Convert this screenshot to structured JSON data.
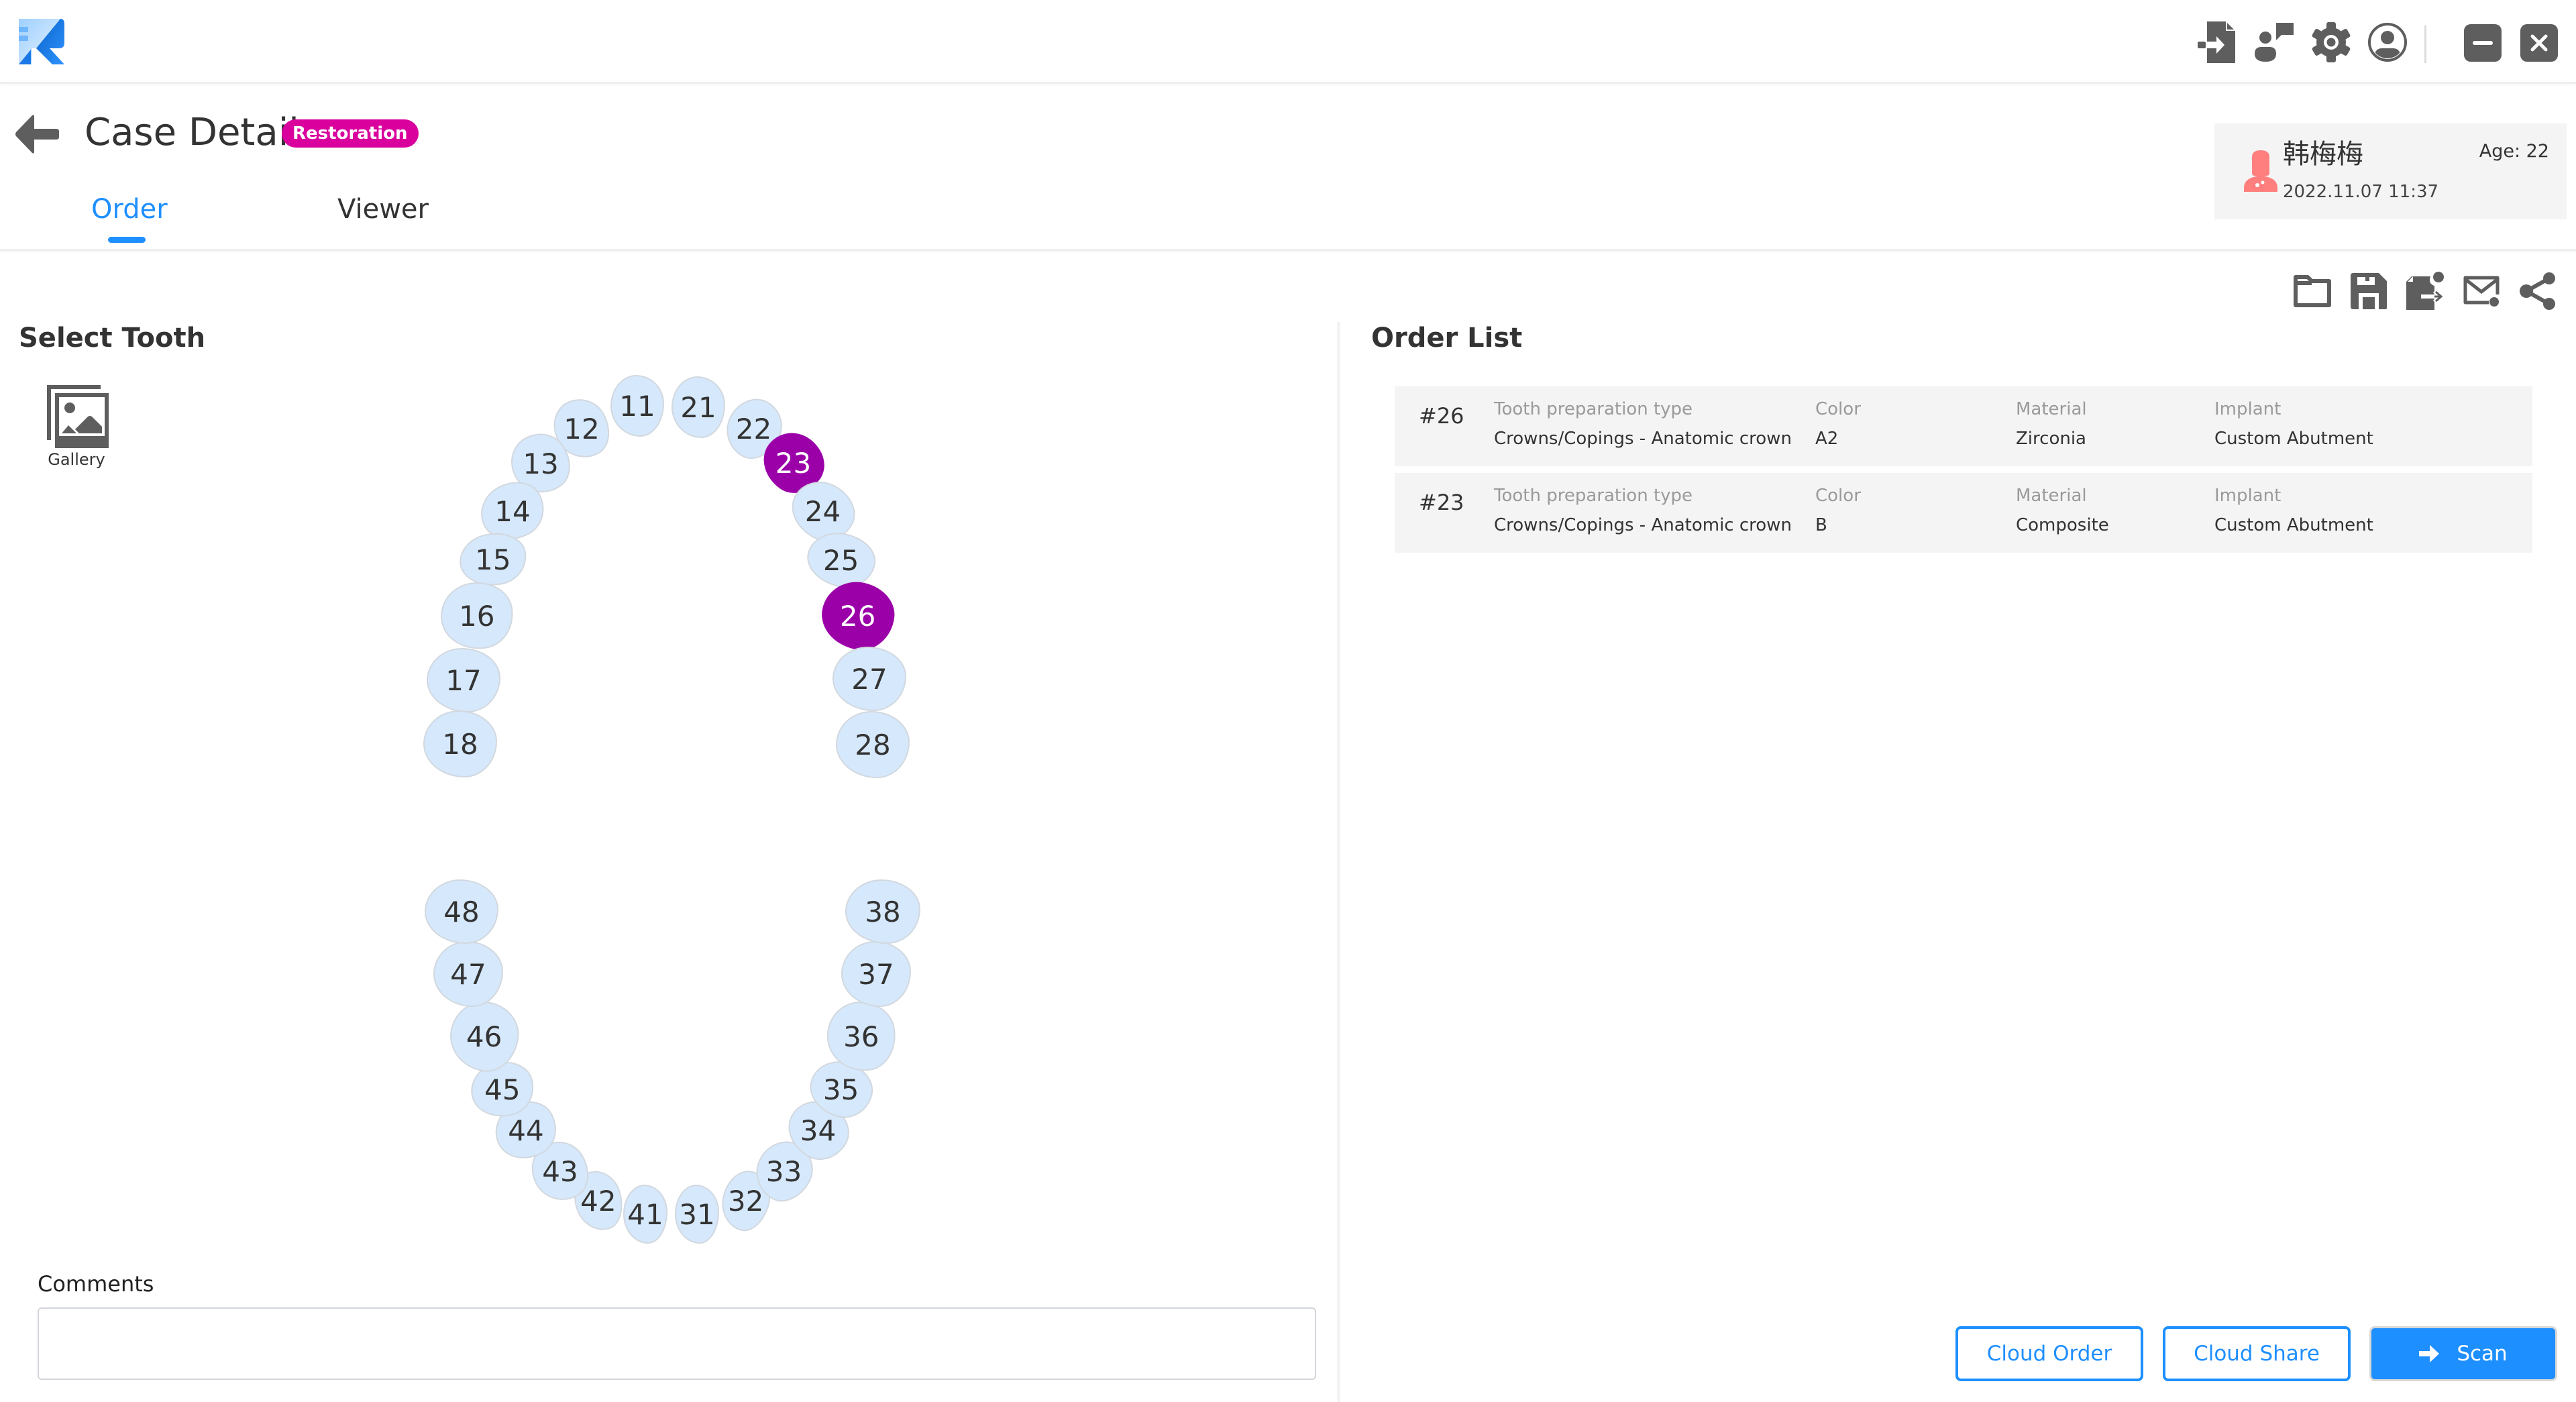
{
  "app": {
    "logo": "r-logo",
    "toolbar_icons": [
      "import-icon",
      "feedback-icon",
      "gear-icon",
      "account-icon"
    ],
    "window_controls": [
      "minimize-icon",
      "close-icon"
    ]
  },
  "header": {
    "title": "Case Detail",
    "badge": "Restoration",
    "tabs": [
      {
        "label": "Order",
        "active": true
      },
      {
        "label": "Viewer",
        "active": false
      }
    ]
  },
  "patient": {
    "name": "韩梅梅",
    "date": "2022.11.07 11:37",
    "age": "Age: 22",
    "avatar_icon": "female-patient-icon"
  },
  "select_tooth": {
    "title": "Select Tooth",
    "gallery_label": "Gallery",
    "teeth": [
      {
        "number": "11",
        "selected": false
      },
      {
        "number": "12",
        "selected": false
      },
      {
        "number": "13",
        "selected": false
      },
      {
        "number": "14",
        "selected": false
      },
      {
        "number": "15",
        "selected": false
      },
      {
        "number": "16",
        "selected": false
      },
      {
        "number": "17",
        "selected": false
      },
      {
        "number": "18",
        "selected": false
      },
      {
        "number": "21",
        "selected": false
      },
      {
        "number": "22",
        "selected": false
      },
      {
        "number": "23",
        "selected": true
      },
      {
        "number": "24",
        "selected": false
      },
      {
        "number": "25",
        "selected": false
      },
      {
        "number": "26",
        "selected": true
      },
      {
        "number": "27",
        "selected": false
      },
      {
        "number": "28",
        "selected": false
      },
      {
        "number": "31",
        "selected": false
      },
      {
        "number": "32",
        "selected": false
      },
      {
        "number": "33",
        "selected": false
      },
      {
        "number": "34",
        "selected": false
      },
      {
        "number": "35",
        "selected": false
      },
      {
        "number": "36",
        "selected": false
      },
      {
        "number": "37",
        "selected": false
      },
      {
        "number": "38",
        "selected": false
      },
      {
        "number": "41",
        "selected": false
      },
      {
        "number": "42",
        "selected": false
      },
      {
        "number": "43",
        "selected": false
      },
      {
        "number": "44",
        "selected": false
      },
      {
        "number": "45",
        "selected": false
      },
      {
        "number": "46",
        "selected": false
      },
      {
        "number": "47",
        "selected": false
      },
      {
        "number": "48",
        "selected": false
      }
    ],
    "colors": {
      "tooth": "#d6e8fb",
      "selected": "#9B00A8"
    }
  },
  "comments": {
    "label": "Comments",
    "value": "",
    "placeholder": ""
  },
  "order_list": {
    "title": "Order List",
    "action_icons": [
      "folder-icon",
      "save-icon",
      "export-icon",
      "mail-icon",
      "share-icon"
    ],
    "columns": [
      "Tooth preparation type",
      "Color",
      "Material",
      "Implant"
    ],
    "rows": [
      {
        "tooth": "#26",
        "values": [
          "Crowns/Copings - Anatomic crown",
          "A2",
          "Zirconia",
          "Custom Abutment"
        ]
      },
      {
        "tooth": "#23",
        "values": [
          "Crowns/Copings - Anatomic crown",
          "B",
          "Composite",
          "Custom Abutment"
        ]
      }
    ]
  },
  "buttons": {
    "cloud_order": "Cloud Order",
    "cloud_share": "Cloud Share",
    "scan": "Scan"
  },
  "theme": {
    "accent": "#1E8FFF",
    "badge": "#D9009E",
    "icon_gray": "#5e5e5e"
  }
}
